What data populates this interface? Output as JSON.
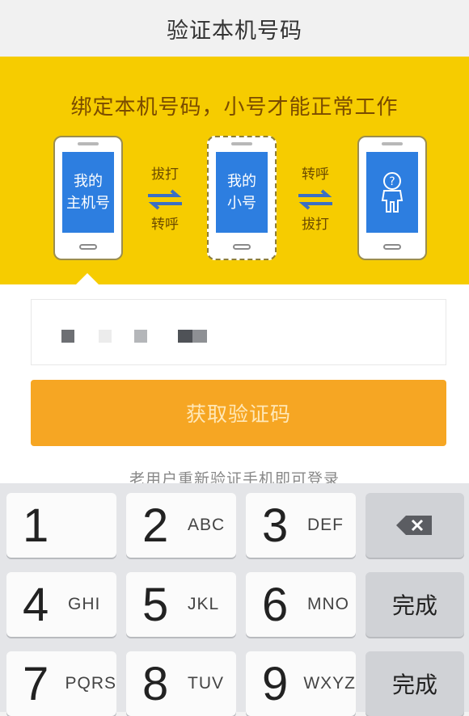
{
  "header": {
    "title": "验证本机号码"
  },
  "banner": {
    "headline": "绑定本机号码，小号才能正常工作",
    "phones": [
      {
        "line1": "我的",
        "line2": "主机号"
      },
      {
        "line1": "我的",
        "line2": "小号"
      },
      {
        "line1": "?",
        "line2": ""
      }
    ],
    "arrows": [
      {
        "top": "拔打",
        "bottom": "转呼"
      },
      {
        "top": "转呼",
        "bottom": "拔打"
      }
    ],
    "colors": {
      "banner": "#f6cc00",
      "screen": "#2d7ee0",
      "headline": "#7a4b00"
    }
  },
  "form": {
    "get_code_button": "获取验证码",
    "tip": "老用户重新验证手机即可登录",
    "cta_color": "#f6a623"
  },
  "keyboard": {
    "keys": [
      {
        "num": "1",
        "letters": ""
      },
      {
        "num": "2",
        "letters": "ABC"
      },
      {
        "num": "3",
        "letters": "DEF"
      },
      {
        "num": "4",
        "letters": "GHI"
      },
      {
        "num": "5",
        "letters": "JKL"
      },
      {
        "num": "6",
        "letters": "MNO"
      },
      {
        "num": "7",
        "letters": "PQRS"
      },
      {
        "num": "8",
        "letters": "TUV"
      },
      {
        "num": "9",
        "letters": "WXYZ"
      }
    ],
    "backspace_icon": "backspace-icon",
    "done_label": "完成",
    "done_label_2": "完成"
  }
}
